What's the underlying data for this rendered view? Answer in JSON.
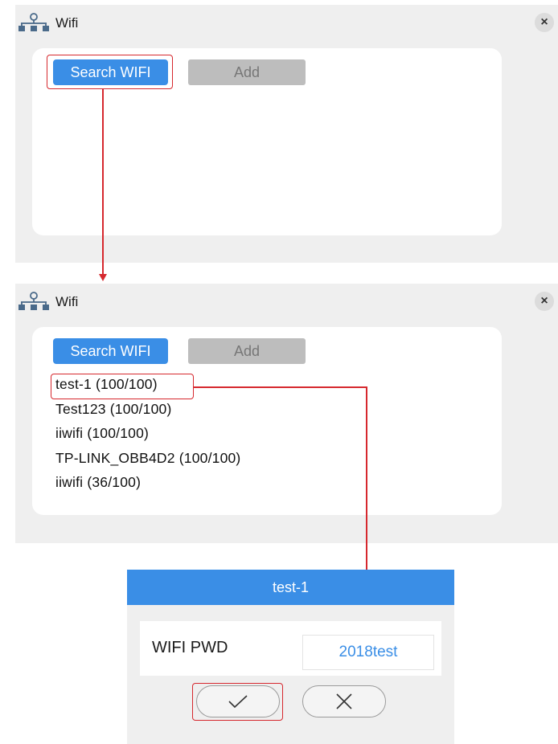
{
  "panels": [
    {
      "title": "Wifi",
      "close_label": "×",
      "search_label": "Search WIFI",
      "add_label": "Add"
    },
    {
      "title": "Wifi",
      "close_label": "×",
      "search_label": "Search WIFI",
      "add_label": "Add",
      "networks": [
        "test-1 (100/100)",
        "Test123 (100/100)",
        "iiwifi (100/100)",
        "TP-LINK_OBB4D2 (100/100)",
        "iiwifi (36/100)"
      ]
    }
  ],
  "dialog": {
    "title": "test-1",
    "pwd_label": "WIFI PWD",
    "pwd_value": "2018test",
    "confirm_icon": "check-icon",
    "cancel_icon": "x-icon"
  },
  "colors": {
    "accent": "#3a8ee6",
    "highlight": "#d6282e",
    "panel_bg": "#efefef",
    "add_bg": "#bdbdbd"
  }
}
